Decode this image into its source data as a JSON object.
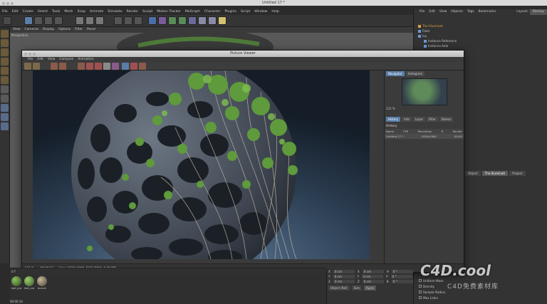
{
  "window": {
    "title": "Untitled 17 *"
  },
  "menubar": [
    "File",
    "Edit",
    "Create",
    "Select",
    "Tools",
    "Mesh",
    "Snap",
    "Animate",
    "Simulate",
    "Render",
    "Sculpt",
    "Motion Tracker",
    "MoGraph",
    "Character",
    "Plugins",
    "Script",
    "Window",
    "Help"
  ],
  "viewport_menu": [
    "View",
    "Cameras",
    "Display",
    "Options",
    "Filter",
    "Panel"
  ],
  "viewport_label": "Perspective",
  "right_panel": {
    "menu": [
      "File",
      "Edit",
      "View",
      "Objects",
      "Tags",
      "Bookmarks"
    ],
    "layout_label": "Layout:",
    "layout_value": "Startup",
    "objects": [
      "The Illuminati",
      "Floor",
      "Ivy",
      "Instance Reference",
      "Instance.Aelo"
    ],
    "attr_tabs": [
      "Object",
      "The Illuminati",
      "Project"
    ],
    "checks": [
      "Uniform Mass",
      "Density",
      "Sample Radius",
      "Max Links"
    ]
  },
  "picture_viewer": {
    "title": "Picture Viewer",
    "menu": [
      "File",
      "Edit",
      "View",
      "Compare",
      "Animation"
    ],
    "status": {
      "zoom": "131 %",
      "time": "00:00:33",
      "size": "Size: 1920x1080, RGB (8Bit), 6.06 MB"
    },
    "side_tabs": [
      "Navigator",
      "Histogram"
    ],
    "side_zoom": "131 %",
    "info_tabs": [
      "History",
      "Info",
      "Layer",
      "Filter",
      "Stereo"
    ],
    "history": {
      "heading": "History",
      "cols": [
        "Name",
        "FPS",
        "Resolution",
        "R",
        "Render"
      ],
      "row": {
        "name": "Untitled 17 *",
        "res": "1920x1080",
        "render": "00:00"
      }
    }
  },
  "materials": [
    {
      "label": "leaf_pro",
      "color": "#4f7a3a"
    },
    {
      "label": "leaf_pro",
      "color": "#5c8a42"
    },
    {
      "label": "branch",
      "color": "#8a7a62"
    }
  ],
  "coords": {
    "rows": [
      {
        "a": "X",
        "av": "0 cm",
        "b": "X",
        "bv": "0 cm",
        "c": "H",
        "cv": "0 °"
      },
      {
        "a": "Y",
        "av": "0 cm",
        "b": "Y",
        "bv": "0 cm",
        "c": "P",
        "cv": "0 °"
      },
      {
        "a": "Z",
        "av": "0 cm",
        "b": "Z",
        "bv": "0 cm",
        "c": "B",
        "cv": "0 °"
      }
    ],
    "mode": "Object (Rel)",
    "size": "Size",
    "apply": "Apply"
  },
  "timeline_start": "0 F",
  "time_readout": "00:00:14",
  "watermark": {
    "main": "C4D.cool",
    "sub": "C4D免费素材库"
  }
}
